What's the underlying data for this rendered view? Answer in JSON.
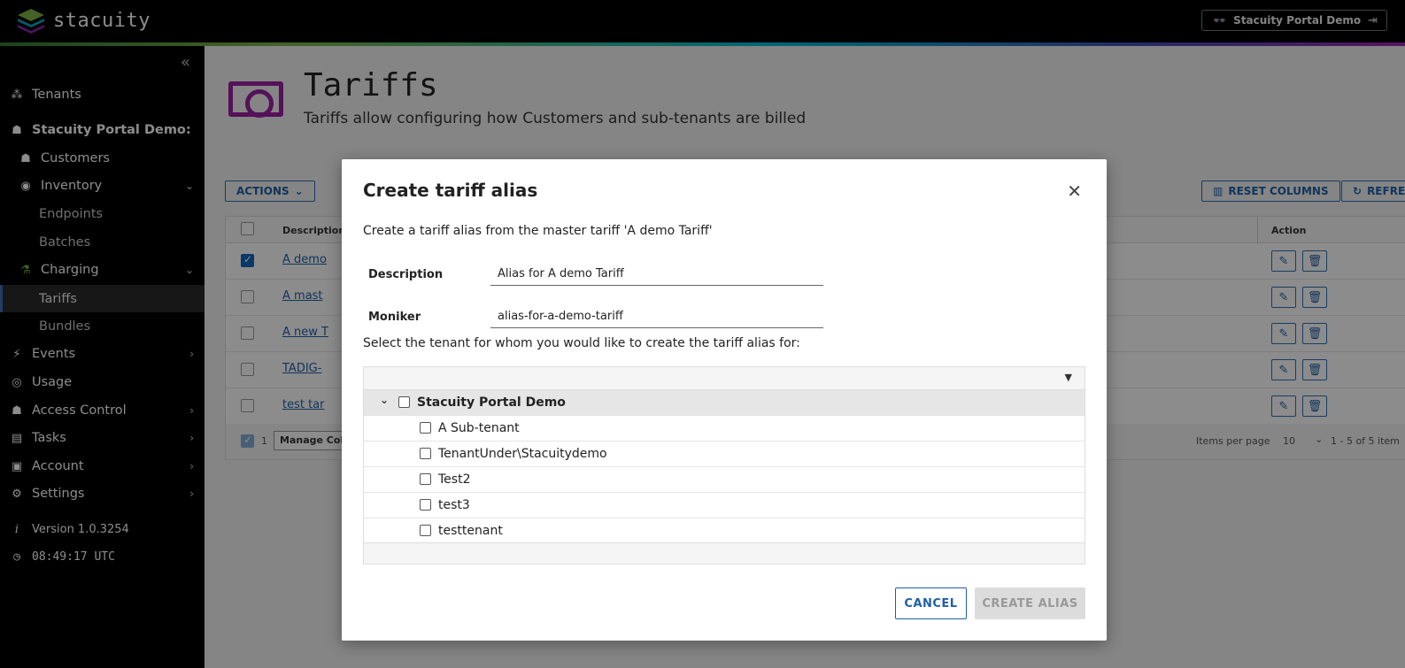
{
  "app": {
    "logo_text": "stacuity",
    "portal_button": "Stacuity Portal Demo"
  },
  "sidebar": {
    "items": [
      {
        "label": "Tenants",
        "icon": "tenants-icon"
      },
      {
        "label": "Stacuity Portal Demo:",
        "icon": "org-icon"
      },
      {
        "label": "Customers",
        "icon": "customers-icon"
      },
      {
        "label": "Inventory",
        "icon": "inventory-icon"
      },
      {
        "label": "Endpoints"
      },
      {
        "label": "Batches"
      },
      {
        "label": "Charging",
        "icon": "charging-icon"
      },
      {
        "label": "Tariffs"
      },
      {
        "label": "Bundles"
      },
      {
        "label": "Events",
        "icon": "events-icon"
      },
      {
        "label": "Usage",
        "icon": "usage-icon"
      },
      {
        "label": "Access Control",
        "icon": "access-control-icon"
      },
      {
        "label": "Tasks",
        "icon": "tasks-icon"
      },
      {
        "label": "Account",
        "icon": "account-icon"
      },
      {
        "label": "Settings",
        "icon": "settings-icon"
      },
      {
        "label": "Version 1.0.3254",
        "icon": "info-icon"
      },
      {
        "label": "08:49:17 UTC",
        "icon": "clock-icon"
      }
    ]
  },
  "page": {
    "title": "Tariffs",
    "subtitle": "Tariffs allow configuring how Customers and sub-tenants are billed",
    "actions_label": "ACTIONS",
    "reset_columns_label": "RESET COLUMNS",
    "refresh_label": "REFRE",
    "grid": {
      "col_description": "Description",
      "col_action": "Action",
      "rows": [
        "A demo",
        "A mast",
        "A new T",
        "TADIG-",
        "test tar"
      ],
      "footer_selected": "1",
      "footer_manage": "Manage Colu",
      "items_per_page_label": "Items per page",
      "items_per_page_value": "10",
      "range": "1 - 5 of 5 item"
    }
  },
  "dialog": {
    "title": "Create tariff alias",
    "description": "Create a tariff alias from the master tariff 'A demo Tariff'",
    "description_label": "Description",
    "description_value": "Alias for A demo Tariff",
    "moniker_label": "Moniker",
    "moniker_value": "alias-for-a-demo-tariff",
    "select_prompt": "Select the tenant for whom you would like to create the tariff alias for:",
    "tree": {
      "root": "Stacuity Portal Demo",
      "children": [
        "A Sub-tenant",
        "TenantUnder\\Stacuitydemo",
        "Test2",
        "test3",
        "testtenant"
      ]
    },
    "cancel_label": "CANCEL",
    "create_label": "CREATE ALIAS"
  }
}
